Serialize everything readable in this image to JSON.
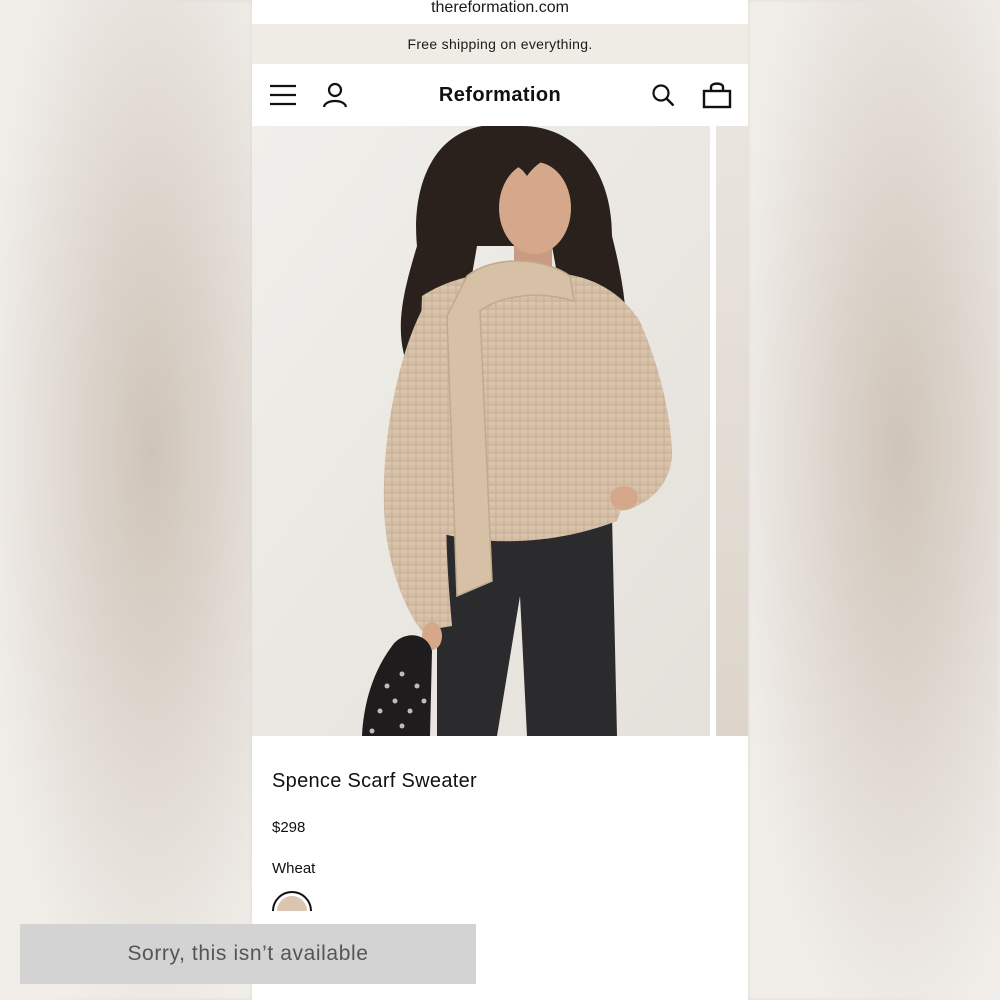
{
  "browser": {
    "url": "thereformation.com"
  },
  "promo": {
    "text": "Free shipping on everything."
  },
  "header": {
    "brand": "Reformation",
    "icons": [
      "menu-icon",
      "account-icon",
      "search-icon",
      "bag-icon"
    ]
  },
  "product": {
    "title": "Spence Scarf Sweater",
    "price": "$298",
    "color_name": "Wheat",
    "swatch_color": "#d9c5b0"
  },
  "cta": {
    "label": "Sorry, this isn’t available"
  },
  "colors": {
    "promo_bg": "#efece6",
    "cta_bg": "#d3d3d3",
    "cta_text": "#555555",
    "sweater": "#d9c3ab",
    "jeans": "#2a2a2c"
  }
}
